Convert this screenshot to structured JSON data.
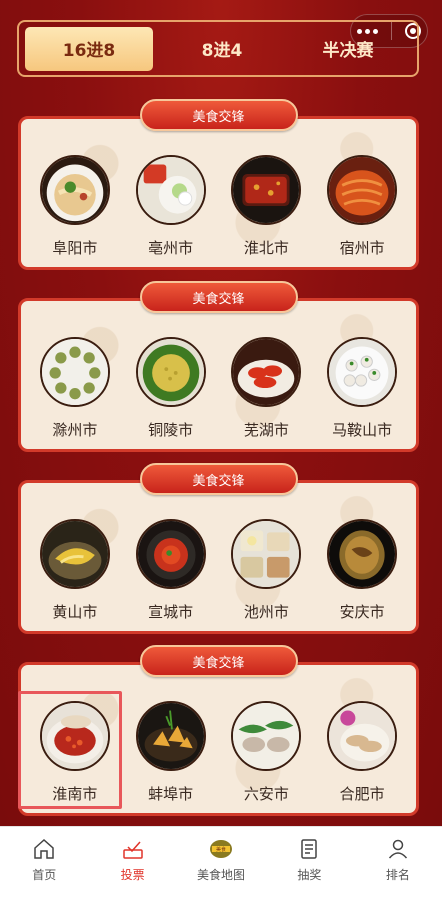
{
  "tabs": [
    {
      "label": "16进8",
      "active": true
    },
    {
      "label": "8进4",
      "active": false
    },
    {
      "label": "半决赛",
      "active": false
    }
  ],
  "sections": [
    {
      "banner": "美食交锋",
      "cities": [
        "阜阳市",
        "亳州市",
        "淮北市",
        "宿州市"
      ]
    },
    {
      "banner": "美食交锋",
      "cities": [
        "滁州市",
        "铜陵市",
        "芜湖市",
        "马鞍山市"
      ]
    },
    {
      "banner": "美食交锋",
      "cities": [
        "黄山市",
        "宣城市",
        "池州市",
        "安庆市"
      ]
    },
    {
      "banner": "美食交锋",
      "cities": [
        "淮南市",
        "蚌埠市",
        "六安市",
        "合肥市"
      ]
    }
  ],
  "nav": [
    {
      "label": "首页",
      "icon": "home-icon",
      "active": false
    },
    {
      "label": "投票",
      "icon": "vote-icon",
      "active": true
    },
    {
      "label": "美食地图",
      "icon": "food-map-icon",
      "active": false
    },
    {
      "label": "抽奖",
      "icon": "lottery-icon",
      "active": false
    },
    {
      "label": "排名",
      "icon": "profile-icon",
      "active": false
    }
  ],
  "colors": {
    "accent": "#e0342a",
    "background": "#8a1010",
    "card": "#f6eadb"
  }
}
